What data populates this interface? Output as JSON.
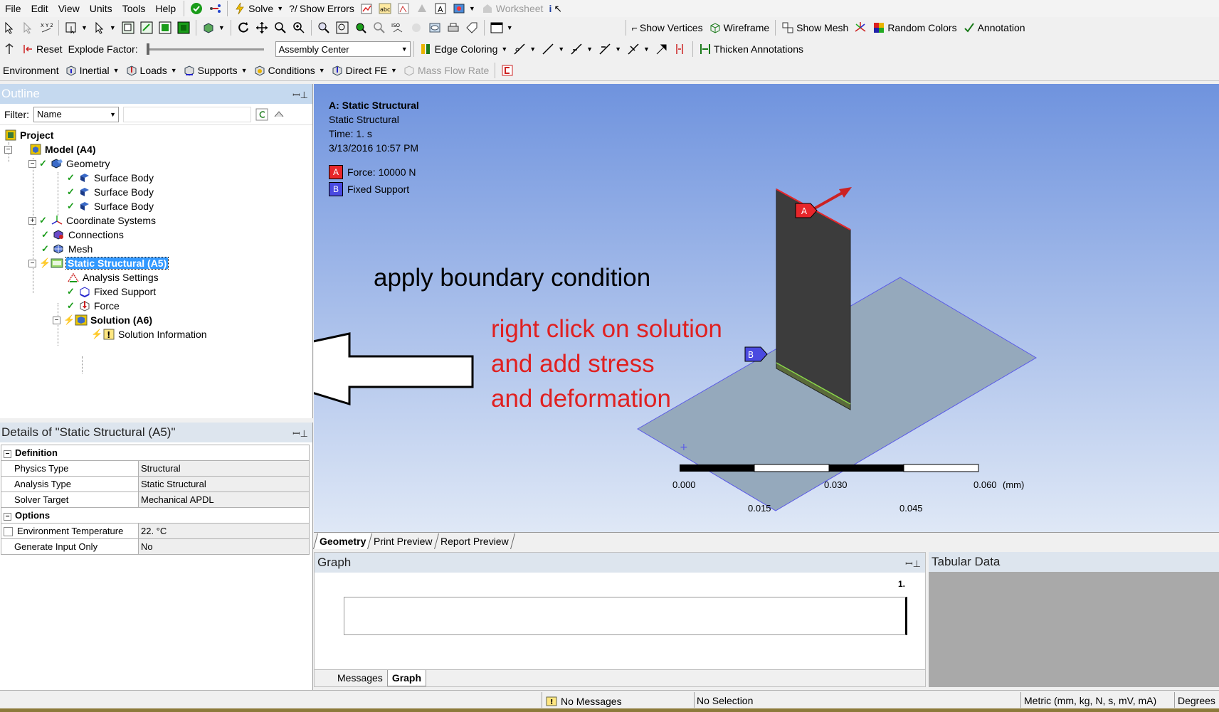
{
  "menubar": {
    "items": [
      "File",
      "Edit",
      "View",
      "Units",
      "Tools",
      "Help"
    ],
    "solve": "Solve",
    "show_errors": "Show Errors",
    "worksheet": "Worksheet"
  },
  "toolbar1": {
    "show_vertices": "Show Vertices",
    "wireframe": "Wireframe",
    "show_mesh": "Show Mesh",
    "random_colors": "Random Colors",
    "annotation": "Annotation"
  },
  "toolbar2": {
    "reset": "Reset",
    "explode_factor": "Explode Factor:",
    "explode_value": 0,
    "assembly_center": "Assembly Center",
    "edge_coloring": "Edge Coloring",
    "thicken_annotations": "Thicken Annotations"
  },
  "toolbar3": {
    "environment": "Environment",
    "inertial": "Inertial",
    "loads": "Loads",
    "supports": "Supports",
    "conditions": "Conditions",
    "direct_fe": "Direct FE",
    "mass_flow_rate": "Mass Flow Rate"
  },
  "outline": {
    "title": "Outline",
    "filter_label": "Filter:",
    "filter_value": "Name",
    "tree": {
      "project": "Project",
      "model": "Model (A4)",
      "geometry": "Geometry",
      "surface_body": "Surface Body",
      "coordinate_systems": "Coordinate Systems",
      "connections": "Connections",
      "mesh": "Mesh",
      "static_structural": "Static Structural (A5)",
      "analysis_settings": "Analysis Settings",
      "fixed_support": "Fixed Support",
      "force": "Force",
      "solution": "Solution (A6)",
      "solution_information": "Solution Information"
    }
  },
  "details": {
    "title": "Details of \"Static Structural (A5)\"",
    "definition": "Definition",
    "physics_type_key": "Physics Type",
    "physics_type_val": "Structural",
    "analysis_type_key": "Analysis Type",
    "analysis_type_val": "Static Structural",
    "solver_target_key": "Solver Target",
    "solver_target_val": "Mechanical APDL",
    "options": "Options",
    "env_temp_key": "Environment Temperature",
    "env_temp_val": "22. °C",
    "gen_input_key": "Generate Input Only",
    "gen_input_val": "No"
  },
  "viewport": {
    "title": "A: Static Structural",
    "subtitle": "Static Structural",
    "time": "Time: 1. s",
    "date": "3/13/2016 10:57 PM",
    "legend": [
      {
        "tag": "A",
        "label": "Force: 10000 N",
        "color": "#e8262a"
      },
      {
        "tag": "B",
        "label": "Fixed Support",
        "color": "#4a4ae0"
      }
    ],
    "annotation_black": "apply boundary condition",
    "annotation_red": [
      "right click on solution",
      "and add stress",
      "and deformation"
    ],
    "scale": {
      "top_labels": [
        "0.000",
        "0.030",
        "0.060"
      ],
      "unit": "(mm)",
      "bottom_labels": [
        "0.015",
        "0.045"
      ]
    }
  },
  "view_tabs": [
    "Geometry",
    "Print Preview",
    "Report Preview"
  ],
  "graph": {
    "title": "Graph",
    "tick": "1.",
    "tabs": [
      "Messages",
      "Graph"
    ]
  },
  "tabular": {
    "title": "Tabular Data"
  },
  "status": {
    "messages": "No Messages",
    "selection": "No Selection",
    "units": "Metric (mm, kg, N, s, mV, mA)",
    "angle": "Degrees"
  },
  "colors": {
    "selection": "#3399ff",
    "annotation_red": "#e02020",
    "viewport_top": "#6f93de"
  }
}
